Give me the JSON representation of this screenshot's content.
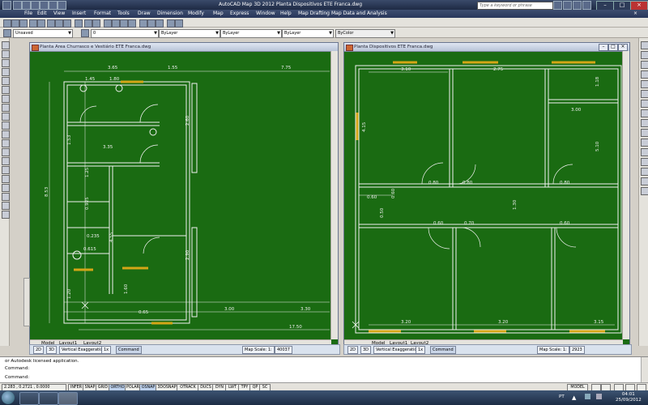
{
  "app": {
    "title": "AutoCAD Map 3D 2012   Planta Dispositivos ETE Franca.dwg",
    "search_placeholder": "Type a keyword or phrase"
  },
  "menu": [
    "File",
    "Edit",
    "View",
    "Insert",
    "Format",
    "Tools",
    "Draw",
    "Dimension",
    "Modify",
    "Map",
    "Express",
    "Window",
    "Help",
    "Map Drafting",
    "Map Data and Analysis"
  ],
  "toolbar": {
    "workspace": "Unsaved",
    "layer": "0",
    "color": "ByLayer",
    "linetype": "ByLayer",
    "lineweight": "ByLayer",
    "plotstyle": "ByColor"
  },
  "left_window": {
    "title": "Planta Area Churrasco e Vestiário ETE Franca.dwg",
    "tabs": [
      "Model",
      "Layout1",
      "Layout2"
    ],
    "dims": {
      "d365": "3.65",
      "d155": "1.55",
      "d775": "7.75",
      "d145": "1.45",
      "d180": "1.80",
      "d335": "3.35",
      "d153": "1.53",
      "d125": "1.25",
      "d455": "4.55",
      "d853": "8.53",
      "d0925": "0.925",
      "d0235": "0.235",
      "d0615": "0.615",
      "d120": "1.20",
      "d260": "2.60",
      "d290": "2.90",
      "d300": "3.00",
      "d330": "3.30",
      "d1750": "17.50",
      "d0065": "0.65",
      "d160": "1.60"
    },
    "status": {
      "d2": "2D",
      "d3": "3D",
      "exag": "Vertical Exaggeration:",
      "exag_val": "1x",
      "command": "Command",
      "scale_label": "Map Scale: 1:",
      "scale_val": "40037"
    }
  },
  "right_window": {
    "title": "Planta Dispositivos ETE Franca.dwg",
    "tabs": [
      "Model",
      "Layout1",
      "Layout2"
    ],
    "dims": {
      "d310": "3.10",
      "d275": "2.75",
      "d300": "3.00",
      "d118": "1.18",
      "d510": "5.10",
      "d415": "4.15",
      "d080a": "0.80",
      "d080b": "0.80",
      "d080c": "0.80",
      "d060a": "0.60",
      "d130": "1.30",
      "d060b": "0.60",
      "d050": "0.50",
      "d070": "0.70",
      "d060c": "0.60",
      "d325": "3.20",
      "d320": "3.20",
      "d315": "3.15"
    },
    "status": {
      "d2": "2D",
      "d3": "3D",
      "exag": "Vertical Exaggeration:",
      "exag_val": "1x",
      "command": "Command",
      "scale_label": "Map Scale: 1:",
      "scale_val": "2923"
    }
  },
  "command": {
    "line1": "or Autodesk licensed application.",
    "line2": "Command:",
    "line3": "Command:"
  },
  "statusbar": {
    "coords": "2.283 , 0.2721 , 0.0000",
    "buttons": [
      "INFER",
      "SNAP",
      "GRID",
      "ORTHO",
      "POLAR",
      "OSNAP",
      "3DOSNAP",
      "OTRACK",
      "DUCS",
      "DYN",
      "LWT",
      "TPY",
      "QP",
      "SC"
    ],
    "model": "MODEL"
  },
  "taskbar": {
    "lang": "PT",
    "time": "04:01",
    "date": "25/09/2012"
  },
  "colors": {
    "canvas": "#1a6b12",
    "wall": "#f2f2f2",
    "window_mark": "#d4a617",
    "dim_text": "#f0f0f0"
  }
}
